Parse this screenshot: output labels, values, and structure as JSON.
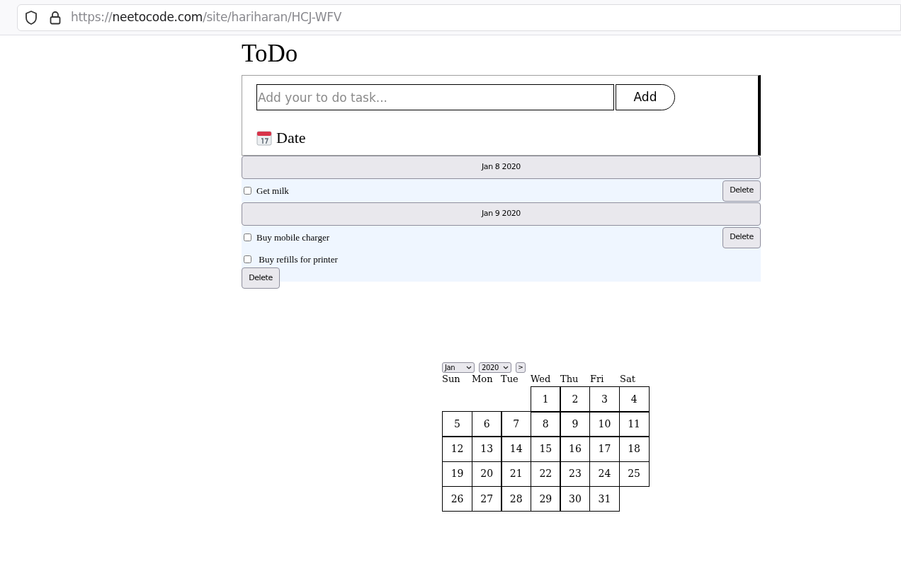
{
  "browser": {
    "url_scheme": "https://",
    "url_host": "neetocode.com",
    "url_path": "/site/hariharan/HCJ-WFV"
  },
  "title": "ToDo",
  "new_task": {
    "placeholder": "Add your to do task...",
    "add_label": "Add"
  },
  "date_heading": "Date",
  "groups": [
    {
      "date": "Jan 8 2020",
      "tasks": [
        {
          "text": "Get milk",
          "checked": false,
          "kind": "inline",
          "delete_label": "Delete"
        }
      ]
    },
    {
      "date": "Jan 9 2020",
      "tasks": [
        {
          "text": "Buy mobile charger",
          "checked": false,
          "kind": "inline",
          "delete_label": "Delete"
        },
        {
          "text": " Buy refills for printer",
          "checked": false,
          "kind": "wrapped",
          "delete_label": "Delete"
        }
      ]
    }
  ],
  "calendar": {
    "month": "Jan",
    "year": "2020",
    "next_label": ">",
    "weekdays": [
      "Sun",
      "Mon",
      "Tue",
      "Wed",
      "Thu",
      "Fri",
      "Sat"
    ],
    "weeks": [
      {
        "kind": "end",
        "days": [
          "1",
          "2",
          "3",
          "4"
        ]
      },
      {
        "kind": "start",
        "days": [
          "5",
          "6",
          "7",
          "8",
          "9",
          "10",
          "11"
        ]
      },
      {
        "kind": "start",
        "days": [
          "12",
          "13",
          "14",
          "15",
          "16",
          "17",
          "18"
        ]
      },
      {
        "kind": "start",
        "days": [
          "19",
          "20",
          "21",
          "22",
          "23",
          "24",
          "25"
        ]
      },
      {
        "kind": "start",
        "days": [
          "26",
          "27",
          "28",
          "29",
          "30",
          "31"
        ]
      }
    ]
  }
}
